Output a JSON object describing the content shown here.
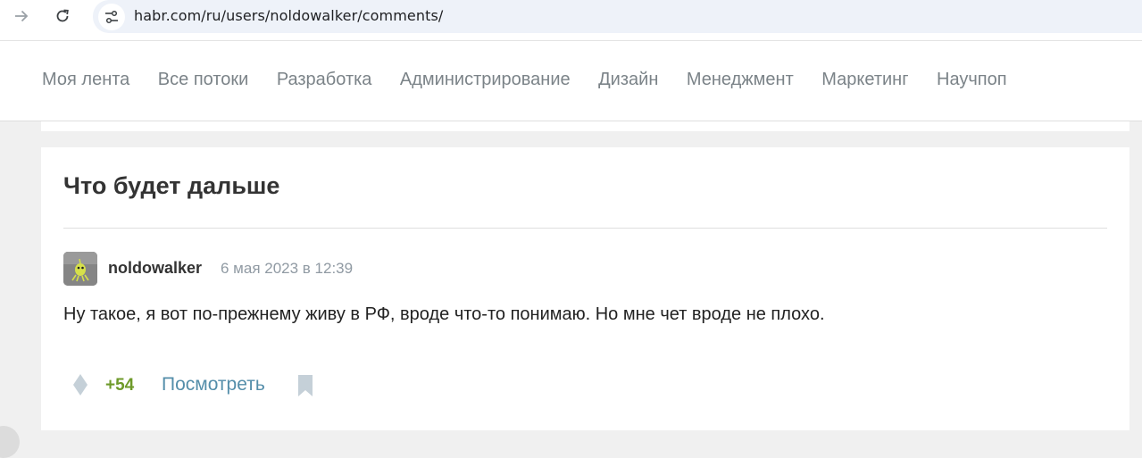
{
  "browser": {
    "url": "habr.com/ru/users/noldowalker/comments/",
    "icons": [
      "forward-icon",
      "reload-icon",
      "site-info-icon"
    ]
  },
  "header": {
    "flows": [
      {
        "label": "Моя лента"
      },
      {
        "label": "Все потоки"
      },
      {
        "label": "Разработка"
      },
      {
        "label": "Администрирование"
      },
      {
        "label": "Дизайн"
      },
      {
        "label": "Менеджмент"
      },
      {
        "label": "Маркетинг"
      },
      {
        "label": "Научпоп"
      }
    ]
  },
  "article": {
    "title": "Что будет дальше"
  },
  "comment": {
    "author": "noldowalker",
    "date": "6 мая 2023 в 12:39",
    "text": "Ну такое, я вот по-прежнему живу в РФ, вроде что-то понимаю. Но мне чет вроде не плохо.",
    "score": "+54",
    "view_label": "Посмотреть"
  },
  "colors": {
    "score": "#6e9a2a",
    "link": "#548eaa",
    "muted": "#909aa3",
    "icon": "#c5d0d8"
  }
}
